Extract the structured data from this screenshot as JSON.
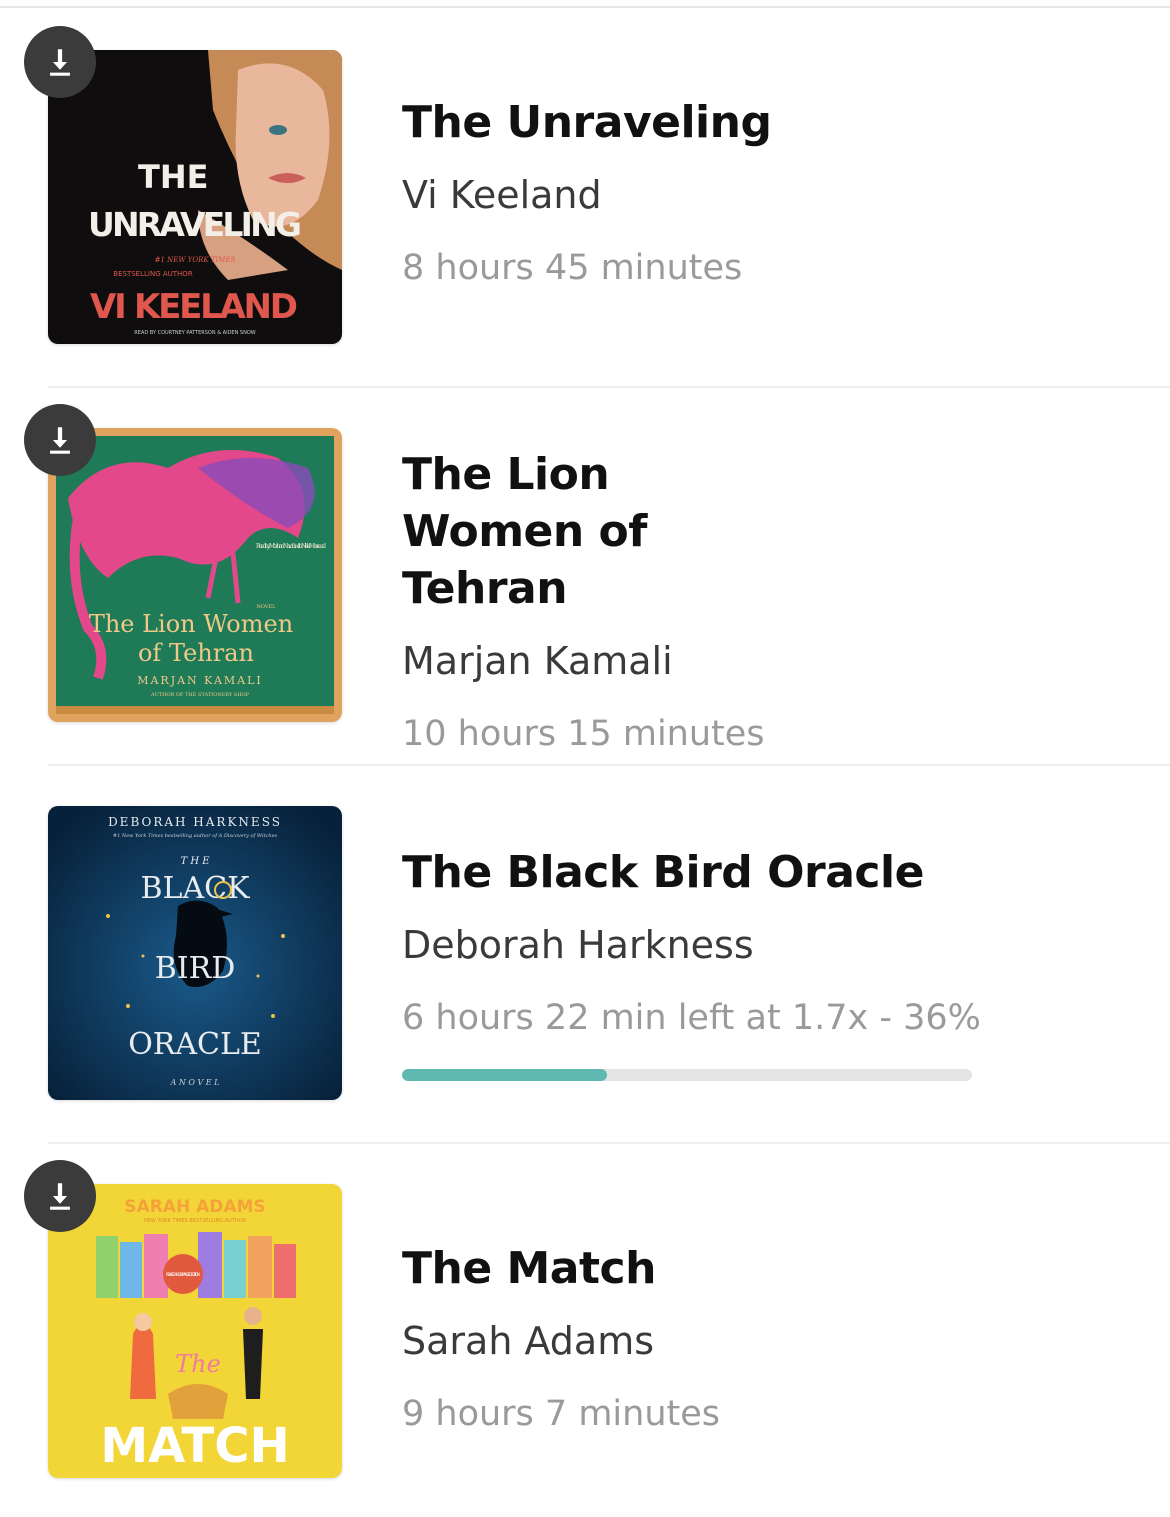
{
  "books": [
    {
      "title": "The Unraveling",
      "author": "Vi Keeland",
      "duration": "8 hours 45 minutes",
      "downloaded_icon": "download-icon",
      "cover": {
        "title_line1": "THE",
        "title_line2": "UNRAVELING",
        "tagline1": "#1 NEW YORK TIMES",
        "tagline2": "BESTSELLING AUTHOR",
        "author": "VI KEELAND",
        "narrators": "READ BY COURTNEY PATTERSON & AIDEN SNOW",
        "colors": {
          "bg": "#0f0d0d",
          "title": "#f2efe9",
          "author": "#e0574d",
          "skin": "#e9b79b",
          "hair": "#c58a55"
        }
      }
    },
    {
      "title": "The Lion Women of Tehran",
      "author": "Marjan Kamali",
      "duration": "10 hours 15 minutes",
      "downloaded_icon": "download-icon",
      "cover": {
        "title_line1": "The Lion Women",
        "title_line2": "of Tehran",
        "label": "NOVEL",
        "author": "MARJAN KAMALI",
        "author_note": "AUTHOR OF THE STATIONERY SHOP",
        "read_by": "Read by Mozhan Navabi with Nikki Massoud",
        "colors": {
          "bg": "#1f7a57",
          "frame": "#e0a35e",
          "bird": "#e2488a",
          "text": "#f0c988"
        }
      }
    },
    {
      "title": "The Black Bird Oracle",
      "author": "Deborah Harkness",
      "duration": "6 hours 22 min left at 1.7x - 36%",
      "progress": 0.36,
      "cover": {
        "author": "DEBORAH HARKNESS",
        "subtitle": "#1 New York Times bestselling author of A Discovery of Witches",
        "word_the": "T H E",
        "word1": "BLACK",
        "word2": "BIRD",
        "word3": "ORACLE",
        "label": "A  N O V E L",
        "colors": {
          "bg": "#0e3a5f",
          "text": "#e8ecef",
          "star": "#f1c24a"
        }
      }
    },
    {
      "title": "The Match",
      "author": "Sarah Adams",
      "duration": "9 hours 7 minutes",
      "downloaded_icon": "download-icon",
      "cover": {
        "author": "SARAH ADAMS",
        "subtitle": "NEW YORK TIMES BESTSELLING AUTHOR",
        "badge": "REVISED AND EXPANDED EDITION",
        "word_the": "The",
        "word_match": "MATCH",
        "colors": {
          "bg": "#f2d537",
          "text": "#ffffff",
          "author": "#f6a23a"
        }
      }
    }
  ],
  "colors": {
    "progress_fill": "#5fb9b1",
    "progress_track": "#e4e4e4",
    "download_bg": "#3b3b3b"
  }
}
